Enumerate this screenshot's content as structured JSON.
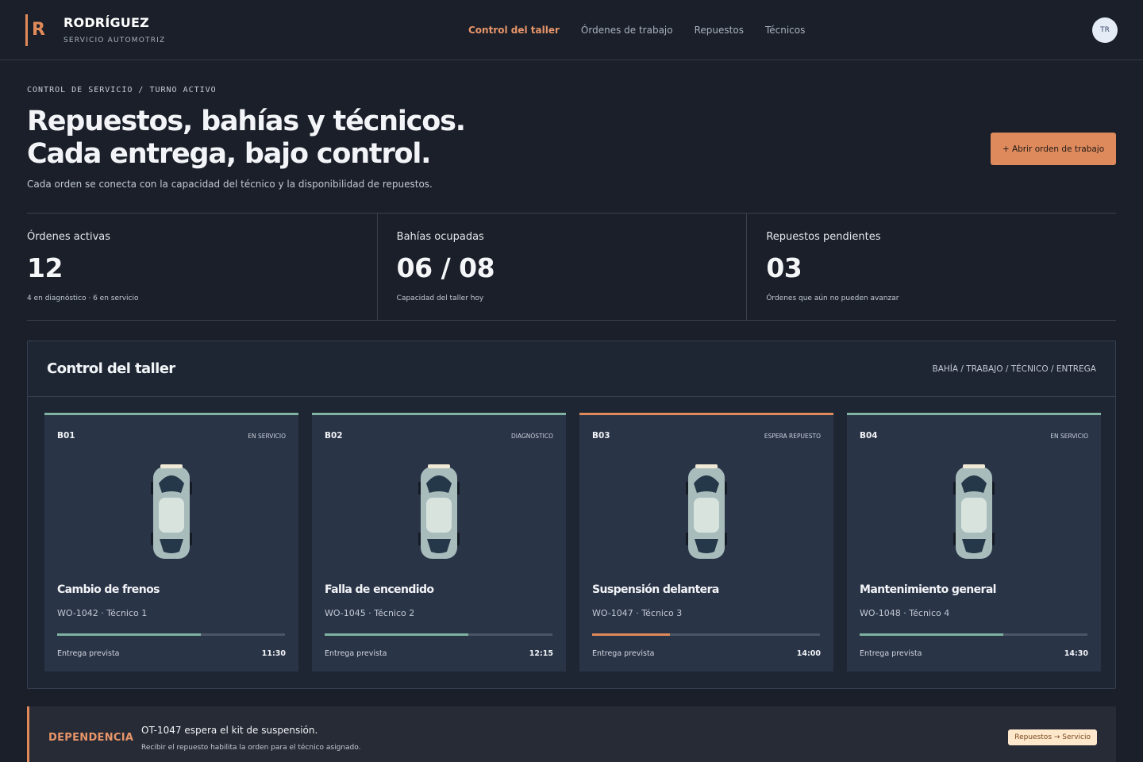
{
  "brand": {
    "mark": "R",
    "name": "RODRÍGUEZ",
    "subtitle": "SERVICIO AUTOMOTRIZ"
  },
  "nav": {
    "items": [
      {
        "label": "Control del taller",
        "active": true
      },
      {
        "label": "Órdenes de trabajo",
        "active": false
      },
      {
        "label": "Repuestos",
        "active": false
      },
      {
        "label": "Técnicos",
        "active": false
      }
    ]
  },
  "user": {
    "initials": "TR"
  },
  "hero": {
    "eyebrow": "CONTROL DE SERVICIO / TURNO ACTIVO",
    "title_line1": "Repuestos, bahías y técnicos.",
    "title_line2": "Cada entrega, bajo control.",
    "description": "Cada orden se conecta con la capacidad del técnico y la disponibilidad de repuestos.",
    "cta_label": "+ Abrir orden de trabajo"
  },
  "stats": [
    {
      "label": "Órdenes activas",
      "value": "12",
      "note": "4 en diagnóstico · 6 en servicio"
    },
    {
      "label": "Bahías ocupadas",
      "value": "06 / 08",
      "note": "Capacidad del taller hoy"
    },
    {
      "label": "Repuestos pendientes",
      "value": "03",
      "note": "Órdenes que aún no pueden avanzar"
    }
  ],
  "panel": {
    "title": "Control del taller",
    "legend": "BAHÍA / TRABAJO / TÉCNICO / ENTREGA",
    "bays": [
      {
        "id": "B01",
        "status": "EN SERVICIO",
        "job": "Cambio de frenos",
        "meta": "WO-1042 · Técnico 1",
        "progress": 0.63,
        "due_label": "Entrega prevista",
        "due_time": "11:30",
        "warning": false
      },
      {
        "id": "B02",
        "status": "DIAGNÓSTICO",
        "job": "Falla de encendido",
        "meta": "WO-1045 · Técnico 2",
        "progress": 0.63,
        "due_label": "Entrega prevista",
        "due_time": "12:15",
        "warning": false
      },
      {
        "id": "B03",
        "status": "ESPERA REPUESTO",
        "job": "Suspensión delantera",
        "meta": "WO-1047 · Técnico 3",
        "progress": 0.34,
        "due_label": "Entrega prevista",
        "due_time": "14:00",
        "warning": true
      },
      {
        "id": "B04",
        "status": "EN SERVICIO",
        "job": "Mantenimiento general",
        "meta": "WO-1048 · Técnico 4",
        "progress": 0.63,
        "due_label": "Entrega prevista",
        "due_time": "14:30",
        "warning": false
      }
    ]
  },
  "dependency": {
    "tag": "DEPENDENCIA",
    "title": "OT-1047 espera el kit de suspensión.",
    "subtitle": "Recibir el repuesto habilita la orden para el técnico asignado.",
    "flow": "Repuestos → Servicio"
  },
  "colors": {
    "accent": "#e08a5a",
    "ok": "#7fb3a1",
    "background": "#1a1f29",
    "card": "#2a3447"
  }
}
